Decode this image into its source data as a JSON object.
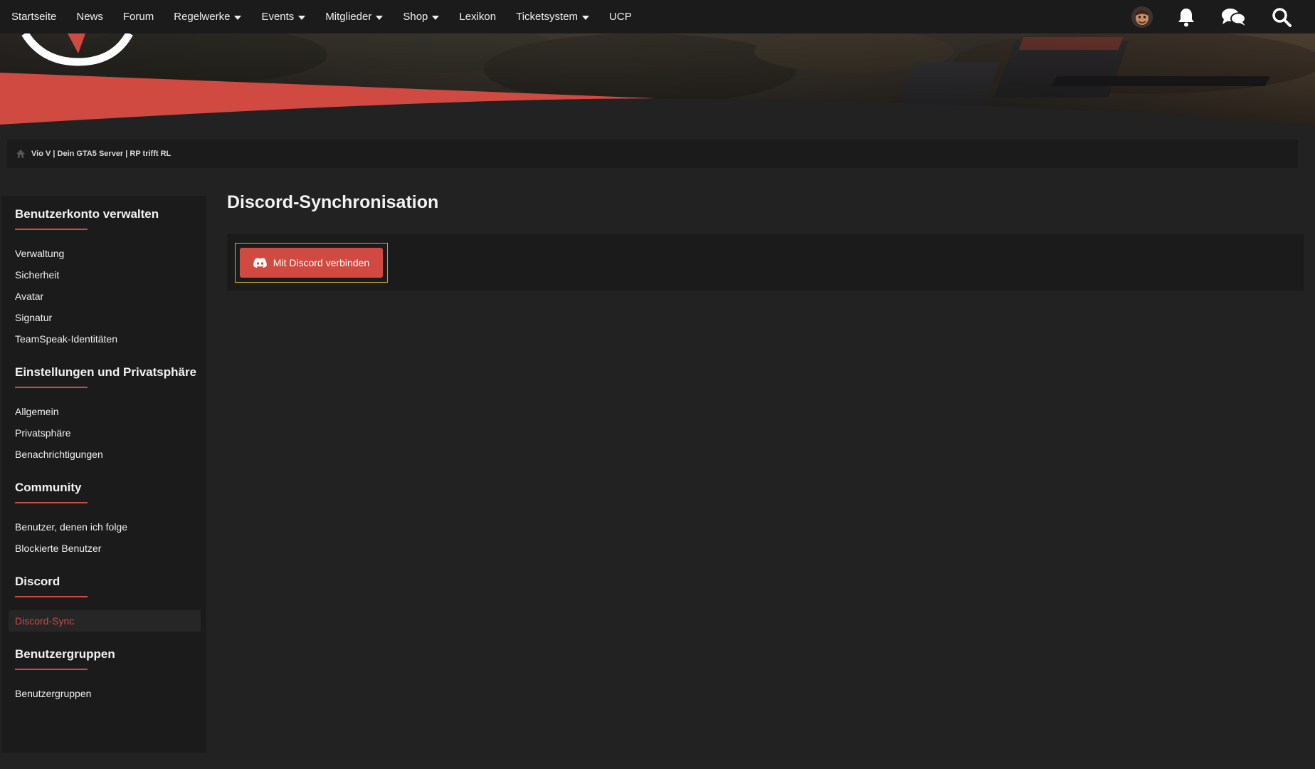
{
  "nav": {
    "items": [
      {
        "label": "Startseite",
        "dropdown": false
      },
      {
        "label": "News",
        "dropdown": false
      },
      {
        "label": "Forum",
        "dropdown": false
      },
      {
        "label": "Regelwerke",
        "dropdown": true
      },
      {
        "label": "Events",
        "dropdown": true
      },
      {
        "label": "Mitglieder",
        "dropdown": true
      },
      {
        "label": "Shop",
        "dropdown": true
      },
      {
        "label": "Lexikon",
        "dropdown": false
      },
      {
        "label": "Ticketsystem",
        "dropdown": true
      },
      {
        "label": "UCP",
        "dropdown": false
      }
    ],
    "icons": [
      "avatar",
      "bell-icon",
      "chat-icon",
      "search-icon"
    ]
  },
  "breadcrumb": {
    "label": "Vio V | Dein GTA5 Server | RP trifft RL"
  },
  "sidebar": {
    "sections": [
      {
        "title": "Benutzerkonto verwalten",
        "links": [
          "Verwaltung",
          "Sicherheit",
          "Avatar",
          "Signatur",
          "TeamSpeak-Identitäten"
        ]
      },
      {
        "title": "Einstellungen und Privatsphäre",
        "links": [
          "Allgemein",
          "Privatsphäre",
          "Benachrichtigungen"
        ]
      },
      {
        "title": "Community",
        "links": [
          "Benutzer, denen ich folge",
          "Blockierte Benutzer"
        ]
      },
      {
        "title": "Discord",
        "links": [
          "Discord-Sync"
        ],
        "active": "Discord-Sync"
      },
      {
        "title": "Benutzergruppen",
        "links": [
          "Benutzergruppen"
        ]
      }
    ]
  },
  "main": {
    "title": "Discord-Synchronisation",
    "connect_button": "Mit Discord verbinden"
  },
  "colors": {
    "accent": "#d04a42",
    "nav_bg": "#1b1b1b",
    "page_bg": "#222222",
    "focus_outline": "#c9b326"
  }
}
